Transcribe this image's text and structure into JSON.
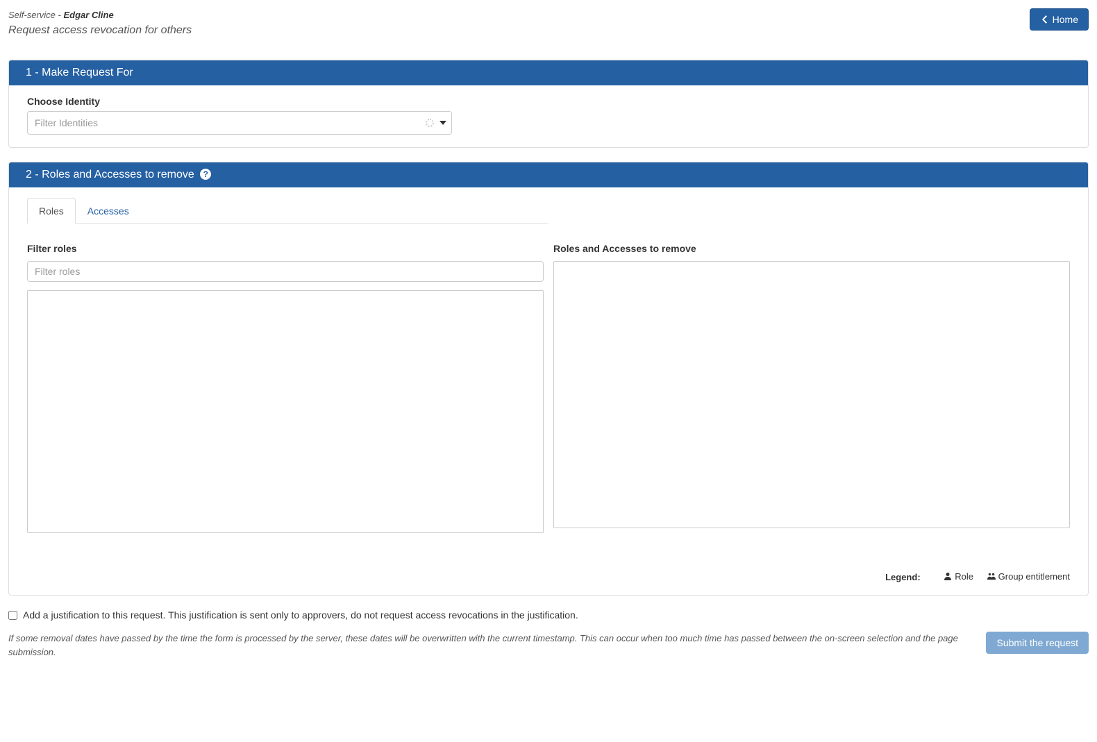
{
  "breadcrumb": {
    "prefix": "Self-service - ",
    "user": "Edgar Cline"
  },
  "page_title": "Request access revocation for others",
  "home_button": "Home",
  "section1": {
    "title": "1 - Make Request For",
    "identity_label": "Choose Identity",
    "identity_placeholder": "Filter Identities"
  },
  "section2": {
    "title": "2 - Roles and Accesses to remove ",
    "tabs": {
      "roles": "Roles",
      "accesses": "Accesses"
    },
    "filter_roles_label": "Filter roles",
    "filter_roles_placeholder": "Filter roles",
    "remove_list_label": "Roles and Accesses to remove",
    "legend_label": "Legend:",
    "legend_role": "Role",
    "legend_group": "Group entitlement"
  },
  "justification": {
    "label": "Add a justification to this request. This justification is sent only to approvers, do not request access revocations in the justification."
  },
  "footer": {
    "note": "If some removal dates have passed by the time the form is processed by the server, these dates will be overwritten with the current timestamp. This can occur when too much time has passed between the on-screen selection and the page submission.",
    "submit": "Submit the request"
  }
}
